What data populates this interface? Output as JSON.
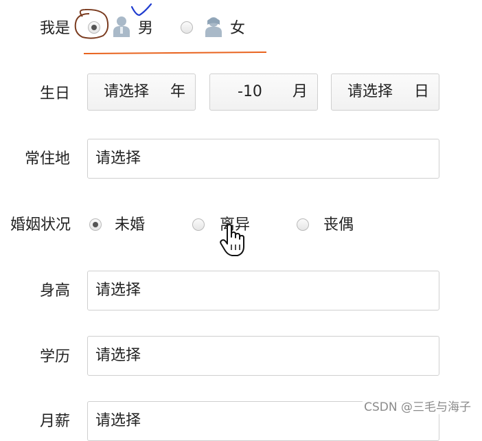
{
  "gender": {
    "label": "我是",
    "options": [
      {
        "text": "男",
        "icon": "male-user-icon",
        "checked": true
      },
      {
        "text": "女",
        "icon": "female-user-icon",
        "checked": false
      }
    ]
  },
  "birthday": {
    "label": "生日",
    "year": {
      "value": "请选择",
      "unit": "年"
    },
    "month": {
      "value": "-10",
      "unit": "月"
    },
    "day": {
      "value": "请选择",
      "unit": "日"
    }
  },
  "residence": {
    "label": "常住地",
    "value": "请选择"
  },
  "marital": {
    "label": "婚姻状况",
    "options": [
      {
        "text": "未婚",
        "checked": true
      },
      {
        "text": "离异",
        "checked": false
      },
      {
        "text": "丧偶",
        "checked": false
      }
    ]
  },
  "height": {
    "label": "身高",
    "value": "请选择"
  },
  "education": {
    "label": "学历",
    "value": "请选择"
  },
  "partial": {
    "label": "月薪",
    "value": "请选择"
  },
  "watermark": "CSDN @三毛与海子",
  "colors": {
    "annotation_brown": "#7a3b1f",
    "annotation_blue": "#1f3ccf",
    "underline_orange": "#e8621d"
  }
}
